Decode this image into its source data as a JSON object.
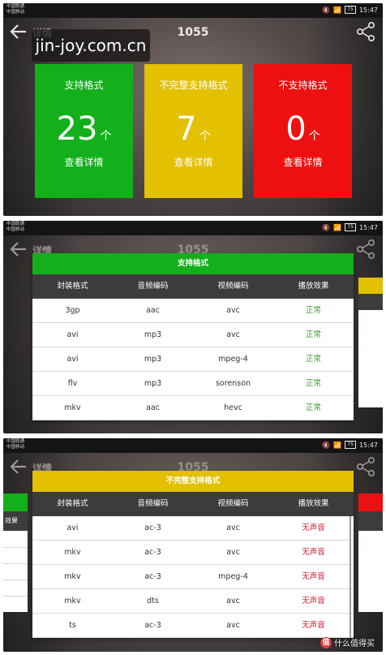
{
  "status": {
    "carrier_line1": "中国联通",
    "carrier_line2": "中国移动",
    "battery": "75",
    "time": "15:47"
  },
  "header": {
    "title": "1055",
    "subtitle": "详情",
    "back_icon": "back-arrow-icon",
    "share_icon": "share-icon"
  },
  "watermark": "jin-joy.com.cn",
  "summary_cards": [
    {
      "label": "支持格式",
      "count": "23",
      "unit": "个",
      "detail": "查看详情",
      "color": "#13b01b"
    },
    {
      "label": "不完整支持格式",
      "count": "7",
      "unit": "个",
      "detail": "查看详情",
      "color": "#e3c000"
    },
    {
      "label": "不支持格式",
      "count": "0",
      "unit": "个",
      "detail": "查看详情",
      "color": "#ee1010"
    }
  ],
  "table_headers": [
    "封装格式",
    "音频编码",
    "视频编码",
    "播放效果"
  ],
  "supported_panel": {
    "title": "支持格式",
    "color": "#13b01b",
    "status_color": "#3c9a2e",
    "rows": [
      [
        "3gp",
        "aac",
        "avc",
        "正常"
      ],
      [
        "avi",
        "mp3",
        "avc",
        "正常"
      ],
      [
        "avi",
        "mp3",
        "mpeg-4",
        "正常"
      ],
      [
        "flv",
        "mp3",
        "sorenson",
        "正常"
      ],
      [
        "mkv",
        "aac",
        "hevc",
        "正常"
      ]
    ]
  },
  "partial_panel": {
    "title": "不完整支持格式",
    "color": "#e3c000",
    "status_color": "#d8162c",
    "rows": [
      [
        "avi",
        "ac-3",
        "avc",
        "无声音"
      ],
      [
        "mkv",
        "ac-3",
        "avc",
        "无声音"
      ],
      [
        "mkv",
        "ac-3",
        "mpeg-4",
        "无声音"
      ],
      [
        "mkv",
        "dts",
        "avc",
        "无声音"
      ],
      [
        "ts",
        "ac-3",
        "avc",
        "无声音"
      ]
    ]
  },
  "peek_left_header": "效果",
  "credit": "值 什么值得买",
  "colors": {
    "green": "#13b01b",
    "yellow": "#e3c000",
    "red": "#ee1010",
    "table_header": "#3c3c3c"
  }
}
